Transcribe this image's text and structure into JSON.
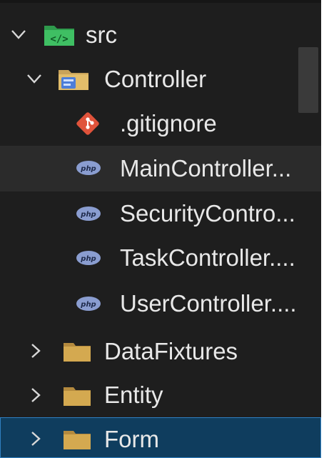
{
  "tree": {
    "root": {
      "label": "src",
      "expanded": true,
      "icon": "folder-src-icon",
      "icon_color": "#2e9a4c"
    },
    "controller": {
      "label": "Controller",
      "expanded": true,
      "icon": "folder-controller-icon",
      "icon_color": "#4d7ed8"
    },
    "files": [
      {
        "label": ".gitignore",
        "icon": "git-icon",
        "icon_color": "#e0533b"
      },
      {
        "label": "MainController...",
        "icon": "php-icon",
        "icon_color": "#8a9dd0",
        "selected": true
      },
      {
        "label": "SecurityContro...",
        "icon": "php-icon",
        "icon_color": "#8a9dd0"
      },
      {
        "label": "TaskController....",
        "icon": "php-icon",
        "icon_color": "#8a9dd0"
      },
      {
        "label": "UserController....",
        "icon": "php-icon",
        "icon_color": "#8a9dd0"
      }
    ],
    "folders": [
      {
        "label": "DataFixtures",
        "expanded": false,
        "icon": "folder-icon",
        "icon_color": "#c9a35a"
      },
      {
        "label": "Entity",
        "expanded": false,
        "icon": "folder-icon",
        "icon_color": "#c9a35a"
      },
      {
        "label": "Form",
        "expanded": false,
        "icon": "folder-icon",
        "icon_color": "#c9a35a",
        "focused": true
      }
    ]
  },
  "colors": {
    "background": "#1e1e1e",
    "selected_row": "#2b2b2b",
    "focused_row": "#0f3d5e",
    "focus_border": "#2f7fc1",
    "text": "#e8e8e8"
  }
}
